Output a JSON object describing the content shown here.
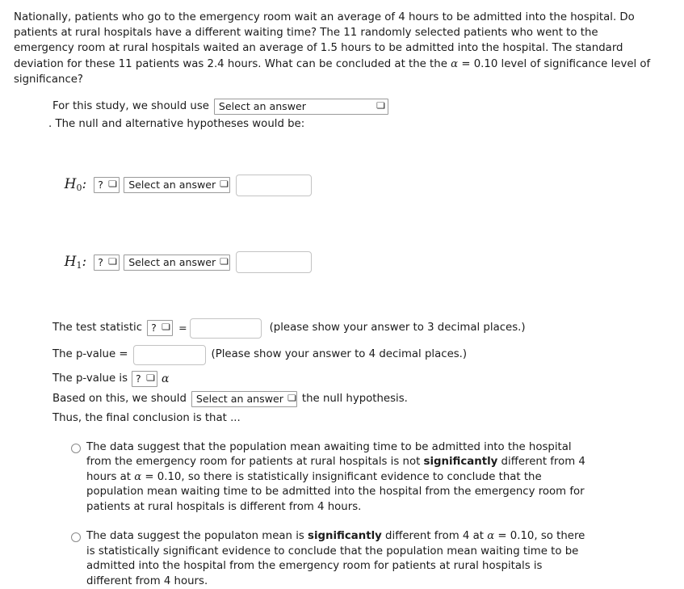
{
  "intro": {
    "text_part1": "Nationally, patients who go to the emergency room wait an average of 4 hours to be admitted into the hospital. Do patients at rural hospitals have a different waiting time? The 11 randomly selected patients who went to the emergency room at rural hospitals waited an average of 1.5 hours to be admitted into the hospital. The standard deviation for these 11 patients was 2.4 hours. What can be concluded at the the ",
    "alpha": "α",
    "text_part2": " = 0.10 level of significance level of significance?"
  },
  "study": {
    "prompt": "For this study, we should use",
    "select_value": "Select an answer",
    "hypotheses_line": ". The null and alternative hypotheses would be:"
  },
  "hypotheses": [
    {
      "label": "H",
      "subscript": "0",
      "colon": ":",
      "op_select": "?",
      "answer_select": "Select an answer",
      "value_input": ""
    },
    {
      "label": "H",
      "subscript": "1",
      "colon": ":",
      "op_select": "?",
      "answer_select": "Select an answer",
      "value_input": ""
    }
  ],
  "test_statistic": {
    "label": "The test statistic",
    "type_select": "?",
    "equals": "=",
    "value_input": "",
    "note": "(please show your answer to 3 decimal places.)"
  },
  "p_value": {
    "label": "The p-value =",
    "value_input": "",
    "note": "(Please show your answer to 4 decimal places.)"
  },
  "p_value_compare": {
    "label": "The p-value is",
    "compare_select": "?",
    "alpha": "α"
  },
  "decision": {
    "prefix": "Based on this, we should",
    "select_value": "Select an answer",
    "suffix": "the null hypothesis."
  },
  "conclusion_prompt": "Thus, the final conclusion is that ...",
  "options": [
    {
      "segments": [
        {
          "text": "The data suggest that the population mean awaiting time to be admitted into the hospital from the emergency room for patients at rural hospitals is not ",
          "style": "normal"
        },
        {
          "text": "significantly",
          "style": "bold"
        },
        {
          "text": " different from 4 hours at ",
          "style": "normal"
        },
        {
          "text": "α",
          "style": "alpha"
        },
        {
          "text": " = 0.10, so there is statistically insignificant evidence to conclude that the population mean waiting time to be admitted into the hospital from the emergency room for patients at rural hospitals is different from 4 hours.",
          "style": "normal"
        }
      ]
    },
    {
      "segments": [
        {
          "text": "The data suggest the populaton mean is ",
          "style": "normal"
        },
        {
          "text": "significantly",
          "style": "bold"
        },
        {
          "text": " different from 4 at ",
          "style": "normal"
        },
        {
          "text": "α",
          "style": "alpha"
        },
        {
          "text": " = 0.10, so there is statistically significant evidence to conclude that the population mean waiting time to be admitted into the hospital from the emergency room for patients at rural hospitals is different from 4 hours.",
          "style": "normal"
        }
      ]
    }
  ],
  "icons": {
    "chevron_down": "⌄"
  }
}
